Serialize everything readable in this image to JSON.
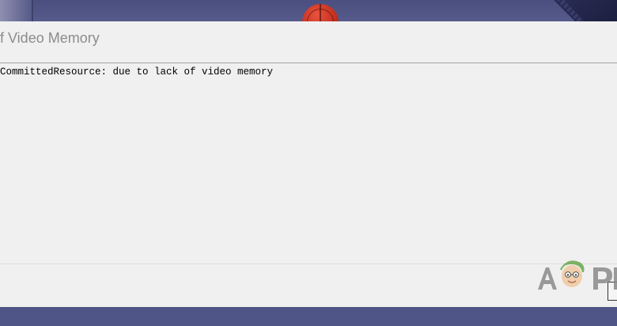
{
  "dialog": {
    "title": "f Video Memory",
    "message": "CommittedResource: due to lack of video memory",
    "ok_label": ""
  },
  "watermark": {
    "text": "APPUALS"
  },
  "colors": {
    "desktop_background": "#4f5586",
    "dialog_background": "#f0f0f0",
    "title_text": "#8c8c8c",
    "message_text": "#000000",
    "basketball": "#c3301f",
    "logo_green": "#6aa84f"
  },
  "icons": {
    "desktop": "basketball-icon",
    "watermark": "appuals-logo"
  }
}
